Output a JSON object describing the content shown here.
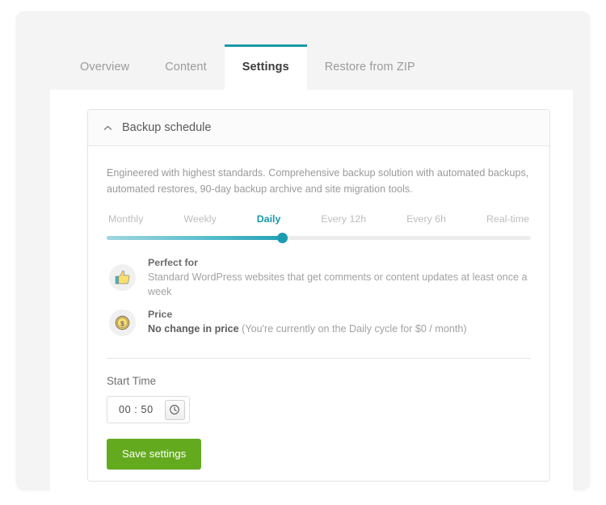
{
  "tabs": [
    {
      "label": "Overview",
      "active": false
    },
    {
      "label": "Content",
      "active": false
    },
    {
      "label": "Settings",
      "active": true
    },
    {
      "label": "Restore from ZIP",
      "active": false
    }
  ],
  "panel": {
    "title": "Backup schedule",
    "collapse_icon": "chevron-up-icon",
    "description": "Engineered with highest standards. Comprehensive backup solution with automated backups, automated restores, 90-day backup archive and site migration tools."
  },
  "slider": {
    "options": [
      "Monthly",
      "Weekly",
      "Daily",
      "Every 12h",
      "Every 6h",
      "Real-time"
    ],
    "selected": "Daily",
    "selected_index": 2,
    "fill_percent": 41.5,
    "accent_color": "#1899a8"
  },
  "info_rows": [
    {
      "icon": "thumbs-up-icon",
      "title": "Perfect for",
      "desc_strong": "",
      "desc": "Standard WordPress websites that get comments or content updates at least once a week"
    },
    {
      "icon": "coin-dollar-icon",
      "title": "Price",
      "desc_strong": "No change in price",
      "desc": "(You're currently on the Daily cycle for $0 / month)"
    }
  ],
  "start_time": {
    "label": "Start Time",
    "value": "00 : 50",
    "placeholder": "00 : 00",
    "clock_icon": "clock-icon"
  },
  "save_button": {
    "label": "Save settings",
    "color": "#63aa1f"
  }
}
